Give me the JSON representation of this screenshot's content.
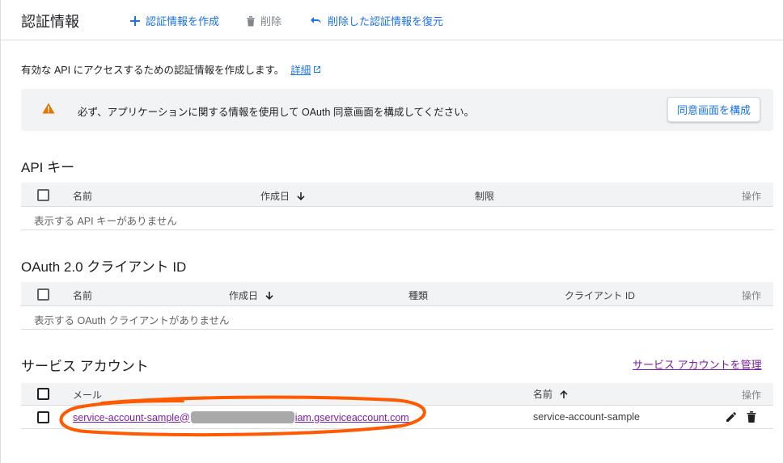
{
  "header": {
    "title": "認証情報",
    "create_label": "認証情報を作成",
    "delete_label": "削除",
    "restore_label": "削除した認証情報を復元"
  },
  "intro": {
    "text": "有効な API にアクセスするための認証情報を作成します。",
    "link": "詳細"
  },
  "banner": {
    "message": "必ず、アプリケーションに関する情報を使用して OAuth 同意画面を構成してください。",
    "button": "同意画面を構成"
  },
  "api_keys": {
    "title": "API キー",
    "columns": {
      "name": "名前",
      "created": "作成日",
      "restriction": "制限",
      "actions": "操作"
    },
    "empty": "表示する API キーがありません"
  },
  "oauth": {
    "title": "OAuth 2.0 クライアント ID",
    "columns": {
      "name": "名前",
      "created": "作成日",
      "type": "種類",
      "client_id": "クライアント ID",
      "actions": "操作"
    },
    "empty": "表示する OAuth クライアントがありません"
  },
  "service_accounts": {
    "title": "サービス アカウント",
    "manage_link": "サービス アカウントを管理",
    "columns": {
      "email": "メール",
      "name": "名前",
      "actions": "操作"
    },
    "rows": [
      {
        "email_prefix": "service-account-sample@",
        "email_suffix": "iam.gserviceaccount.com",
        "name": "service-account-sample"
      }
    ]
  },
  "colors": {
    "accent": "#1a73e8",
    "visited_link": "#7b1fa2",
    "warning": "#e37400",
    "annotation": "#ff5a00"
  },
  "icons": [
    "add-icon",
    "trash-icon",
    "undo-icon",
    "open-in-new-icon",
    "warning-icon",
    "arrow-down-icon",
    "arrow-up-icon",
    "pencil-icon"
  ]
}
